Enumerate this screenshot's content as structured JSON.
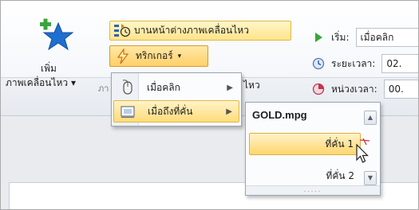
{
  "ribbon": {
    "add_animation": {
      "label_line1": "เพิ่ม",
      "label_line2": "ภาพเคลื่อนไหว ▾",
      "icon": "add-star-icon"
    },
    "group_label_fragment": "ภา",
    "animation_pane_label": "บานหน้าต่างภาพเคลื่อนไหว",
    "trigger_label": "ทริกเกอร์",
    "trigger_caret": "▾",
    "timing": {
      "start_label": "เริ่ม:",
      "start_value": "เมื่อคลิก",
      "duration_label": "ระยะเวลา:",
      "duration_value": "02.",
      "delay_label": "หน่วงเวลา:",
      "delay_value": "00."
    }
  },
  "trigger_menu": {
    "items": [
      {
        "label": "เมื่อคลิก",
        "icon": "mouse-icon"
      },
      {
        "label": "เมื่อถึงที่คั่น",
        "icon": "bookmark-media-icon"
      }
    ],
    "overflow_text": "ไหว"
  },
  "bookmark_menu": {
    "header": "GOLD.mpg",
    "items": [
      {
        "label": "ที่คั่น 1"
      },
      {
        "label": "ที่คั่น 2"
      }
    ],
    "grip": "....."
  },
  "colors": {
    "highlight": "#ffd66e",
    "accent_border": "#e0ae3f",
    "star": "#1f6fd1",
    "plus": "#3aa53a"
  }
}
